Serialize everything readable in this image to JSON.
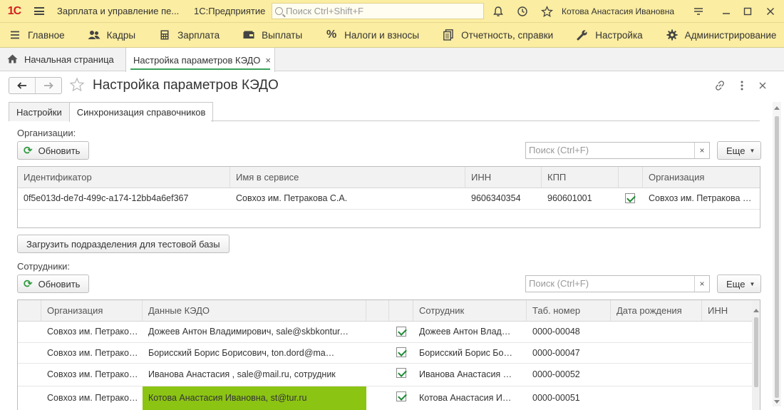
{
  "titlebar": {
    "logo": "1С",
    "app_title": "Зарплата и управление пе...",
    "platform": "1С:Предприятие",
    "search_placeholder": "Поиск Ctrl+Shift+F",
    "user": "Котова Анастасия Ивановна"
  },
  "menu": [
    {
      "label": "Главное",
      "icon": "hamburger-icon"
    },
    {
      "label": "Кадры",
      "icon": "people-icon"
    },
    {
      "label": "Зарплата",
      "icon": "calculator-icon"
    },
    {
      "label": "Выплаты",
      "icon": "wallet-icon"
    },
    {
      "label": "Налоги и взносы",
      "icon": "percent-icon"
    },
    {
      "label": "Отчетность, справки",
      "icon": "reports-icon"
    },
    {
      "label": "Настройка",
      "icon": "wrench-icon"
    },
    {
      "label": "Администрирование",
      "icon": "gear-icon"
    }
  ],
  "tabs": {
    "home": "Начальная страница",
    "active": "Настройка параметров КЭДО"
  },
  "form": {
    "title": "Настройка параметров КЭДО",
    "inner_tabs": [
      "Настройки",
      "Синхронизация справочников"
    ]
  },
  "orgs": {
    "label": "Организации:",
    "refresh": "Обновить",
    "search_placeholder": "Поиск (Ctrl+F)",
    "more": "Еще",
    "columns": [
      "Идентификатор",
      "Имя в сервисе",
      "ИНН",
      "КПП",
      "",
      "Организация"
    ],
    "rows": [
      {
        "id": "0f5e013d-de7d-499c-a174-12bb4a6ef367",
        "name": "Совхоз им. Петракова С.А.",
        "inn": "9606340354",
        "kpp": "960601001",
        "checked": true,
        "org": "Совхоз им. Петракова С.А."
      }
    ]
  },
  "load_button": "Загрузить подразделения для тестовой базы",
  "employees": {
    "label": "Сотрудники:",
    "refresh": "Обновить",
    "search_placeholder": "Поиск (Ctrl+F)",
    "more": "Еще",
    "columns": [
      "",
      "Организация",
      "Данные КЭДО",
      "",
      "",
      "Сотрудник",
      "Таб. номер",
      "Дата рождения",
      "ИНН"
    ],
    "rows": [
      {
        "org": "Совхоз им. Петракова С.А.",
        "kedo": "Дожеев Антон Владимирович, sale@skbkontur.ru",
        "checked": true,
        "employee": "Дожеев Антон Владимирович",
        "tab": "0000-00048",
        "birth": "",
        "inn": "",
        "highlight": false
      },
      {
        "org": "Совхоз им. Петракова С.А.",
        "kedo": "Борисский Борис Борисович, ton.dord@mail.ru",
        "checked": true,
        "employee": "Борисский Борис Борисович",
        "tab": "0000-00047",
        "birth": "",
        "inn": "",
        "highlight": false
      },
      {
        "org": "Совхоз им. Петракова С.А.",
        "kedo": "Иванова Анастасия , sale@mail.ru, сотрудник",
        "checked": true,
        "employee": "Иванова Анастасия Ивановна",
        "tab": "0000-00052",
        "birth": "",
        "inn": "",
        "highlight": false
      },
      {
        "org": "Совхоз им. Петракова С.А.",
        "kedo": "Котова Анастасия Ивановна, st@tur.ru",
        "checked": true,
        "employee": "Котова Анастасия Ивановна",
        "tab": "0000-00051",
        "birth": "",
        "inn": "",
        "highlight": true
      }
    ]
  },
  "colors": {
    "accent_bar": "#fbeda1",
    "highlight": "#8cc414",
    "check": "#1e8a34"
  }
}
